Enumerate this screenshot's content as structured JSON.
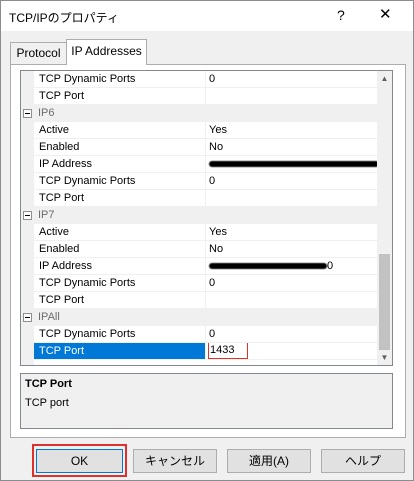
{
  "window": {
    "title": "TCP/IPのプロパティ",
    "help_glyph": "?",
    "close_glyph": "✕"
  },
  "tabs": [
    {
      "label": "Protocol"
    },
    {
      "label": "IP Addresses"
    }
  ],
  "grid": {
    "rows": [
      {
        "type": "prop",
        "name": "TCP Dynamic Ports",
        "value": "0"
      },
      {
        "type": "prop",
        "name": "TCP Port",
        "value": ""
      },
      {
        "type": "cat",
        "name": "IP6"
      },
      {
        "type": "prop",
        "name": "Active",
        "value": "Yes"
      },
      {
        "type": "prop",
        "name": "Enabled",
        "value": "No"
      },
      {
        "type": "prop",
        "name": "IP Address",
        "value": ""
      },
      {
        "type": "prop",
        "name": "TCP Dynamic Ports",
        "value": "0"
      },
      {
        "type": "prop",
        "name": "TCP Port",
        "value": ""
      },
      {
        "type": "cat",
        "name": "IP7"
      },
      {
        "type": "prop",
        "name": "Active",
        "value": "Yes"
      },
      {
        "type": "prop",
        "name": "Enabled",
        "value": "No"
      },
      {
        "type": "prop",
        "name": "IP Address",
        "value": "0"
      },
      {
        "type": "prop",
        "name": "TCP Dynamic Ports",
        "value": "0"
      },
      {
        "type": "prop",
        "name": "TCP Port",
        "value": ""
      },
      {
        "type": "cat",
        "name": "IPAll"
      },
      {
        "type": "prop",
        "name": "TCP Dynamic Ports",
        "value": "0"
      },
      {
        "type": "prop",
        "name": "TCP Port",
        "value": "1433",
        "selected": true
      }
    ]
  },
  "description": {
    "title": "TCP Port",
    "text": "TCP port"
  },
  "buttons": {
    "ok": "OK",
    "cancel": "キャンセル",
    "apply": "適用(A)",
    "help": "ヘルプ"
  },
  "colors": {
    "selection": "#0078d7",
    "highlight_border": "#e0302c"
  }
}
